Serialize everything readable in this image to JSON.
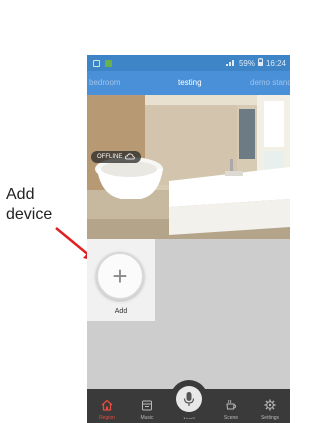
{
  "annotation": {
    "label": "Add device"
  },
  "status_bar": {
    "battery": "59%",
    "time": "16:24"
  },
  "tabs": [
    "bedroom",
    "testing",
    "demo stand"
  ],
  "camera": {
    "status": "OFFLINE"
  },
  "devices": {
    "add_label": "Add"
  },
  "bottom_nav": [
    {
      "label": "Region",
      "icon": "home-icon",
      "active": true
    },
    {
      "label": "Music",
      "icon": "music-icon",
      "active": false
    },
    {
      "label": "Voice",
      "icon": "microphone-icon",
      "active": false
    },
    {
      "label": "Scene",
      "icon": "coffee-cup-icon",
      "active": false
    },
    {
      "label": "Settings",
      "icon": "gear-icon",
      "active": false
    }
  ],
  "colors": {
    "status_bar": "#3d85c6",
    "tab_bar": "#4a90d9",
    "bottom_bar": "#3a3a3a",
    "active": "#e74c3c",
    "annotation_arrow": "#e02020"
  }
}
